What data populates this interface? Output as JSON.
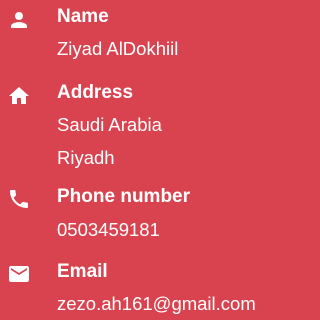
{
  "contact": {
    "name": {
      "icon": "person-icon",
      "label": "Name",
      "value": "Ziyad AlDokhiil"
    },
    "address": {
      "icon": "home-icon",
      "label": "Address",
      "line1": "Saudi Arabia",
      "line2": "Riyadh"
    },
    "phone": {
      "icon": "phone-icon",
      "label": "Phone number",
      "value": "0503459181"
    },
    "email": {
      "icon": "mail-icon",
      "label": "Email",
      "value": "zezo.ah161@gmail.com"
    }
  },
  "colors": {
    "background": "#d9434f",
    "foreground": "#ffffff"
  }
}
